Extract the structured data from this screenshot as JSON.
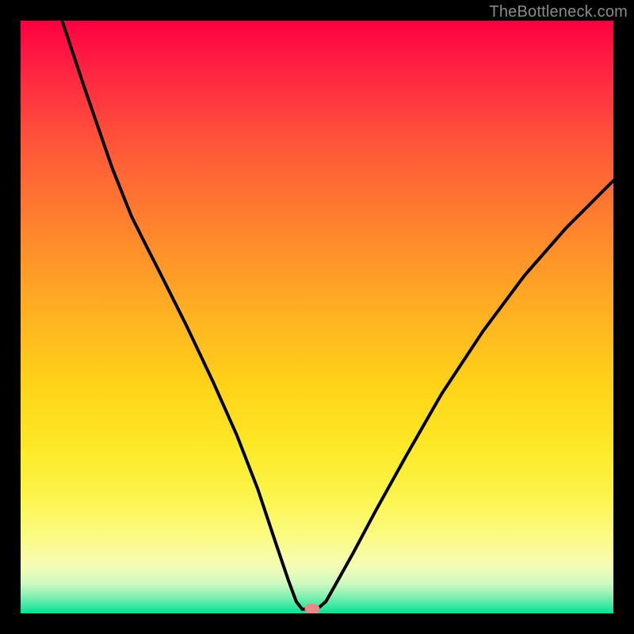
{
  "watermark": "TheBottleneck.com",
  "marker": {
    "x_pct": 49.2,
    "y_pct": 99.3
  },
  "chart_data": {
    "type": "line",
    "title": "",
    "xlabel": "",
    "ylabel": "",
    "xlim": [
      0,
      100
    ],
    "ylim": [
      0,
      100
    ],
    "note": "Percent-space coordinates within the plot area; y is measured from top (0) to bottom (100).",
    "series": [
      {
        "name": "bottleneck-curve",
        "points": [
          {
            "x": 7.0,
            "y": 0.0
          },
          {
            "x": 11.0,
            "y": 12.0
          },
          {
            "x": 15.5,
            "y": 25.0
          },
          {
            "x": 18.7,
            "y": 33.0
          },
          {
            "x": 21.2,
            "y": 38.0
          },
          {
            "x": 24.0,
            "y": 43.5
          },
          {
            "x": 28.0,
            "y": 51.5
          },
          {
            "x": 32.5,
            "y": 61.0
          },
          {
            "x": 36.5,
            "y": 70.0
          },
          {
            "x": 40.0,
            "y": 79.0
          },
          {
            "x": 43.0,
            "y": 88.0
          },
          {
            "x": 45.2,
            "y": 94.5
          },
          {
            "x": 46.5,
            "y": 98.0
          },
          {
            "x": 47.5,
            "y": 99.3
          },
          {
            "x": 50.0,
            "y": 99.3
          },
          {
            "x": 51.5,
            "y": 98.0
          },
          {
            "x": 53.2,
            "y": 95.0
          },
          {
            "x": 56.0,
            "y": 90.0
          },
          {
            "x": 60.0,
            "y": 82.5
          },
          {
            "x": 65.0,
            "y": 73.5
          },
          {
            "x": 71.0,
            "y": 63.0
          },
          {
            "x": 78.0,
            "y": 52.4
          },
          {
            "x": 85.0,
            "y": 43.0
          },
          {
            "x": 92.0,
            "y": 35.0
          },
          {
            "x": 100.0,
            "y": 27.0
          }
        ]
      }
    ],
    "gradient_stops": [
      {
        "pos": 0.0,
        "color": "#ff0040"
      },
      {
        "pos": 0.14,
        "color": "#ff3a3f"
      },
      {
        "pos": 0.32,
        "color": "#ff7a30"
      },
      {
        "pos": 0.52,
        "color": "#ffb820"
      },
      {
        "pos": 0.72,
        "color": "#fde927"
      },
      {
        "pos": 0.87,
        "color": "#fbfb83"
      },
      {
        "pos": 0.95,
        "color": "#cef9c0"
      },
      {
        "pos": 1.0,
        "color": "#0adf90"
      }
    ]
  }
}
